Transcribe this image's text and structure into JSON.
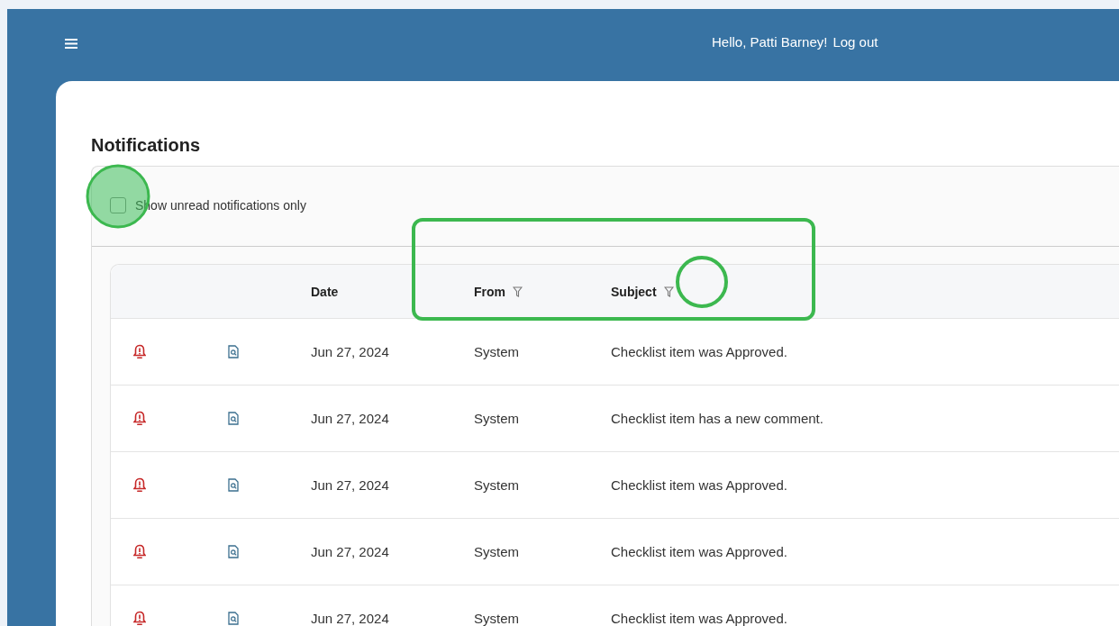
{
  "header": {
    "greeting": "Hello, Patti Barney!",
    "logout": "Log out"
  },
  "page": {
    "title": "Notifications"
  },
  "filter": {
    "label": "Show unread notifications only",
    "checked": false
  },
  "table": {
    "columns": [
      {
        "label": "Date",
        "filter": false
      },
      {
        "label": "From",
        "filter": true
      },
      {
        "label": "Subject",
        "filter": true
      }
    ],
    "rows": [
      {
        "date": "Jun 27, 2024",
        "from": "System",
        "subject": "Checklist item was Approved."
      },
      {
        "date": "Jun 27, 2024",
        "from": "System",
        "subject": "Checklist item has a new comment."
      },
      {
        "date": "Jun 27, 2024",
        "from": "System",
        "subject": "Checklist item was Approved."
      },
      {
        "date": "Jun 27, 2024",
        "from": "System",
        "subject": "Checklist item was Approved."
      },
      {
        "date": "Jun 27, 2024",
        "from": "System",
        "subject": "Checklist item was Approved."
      }
    ]
  }
}
